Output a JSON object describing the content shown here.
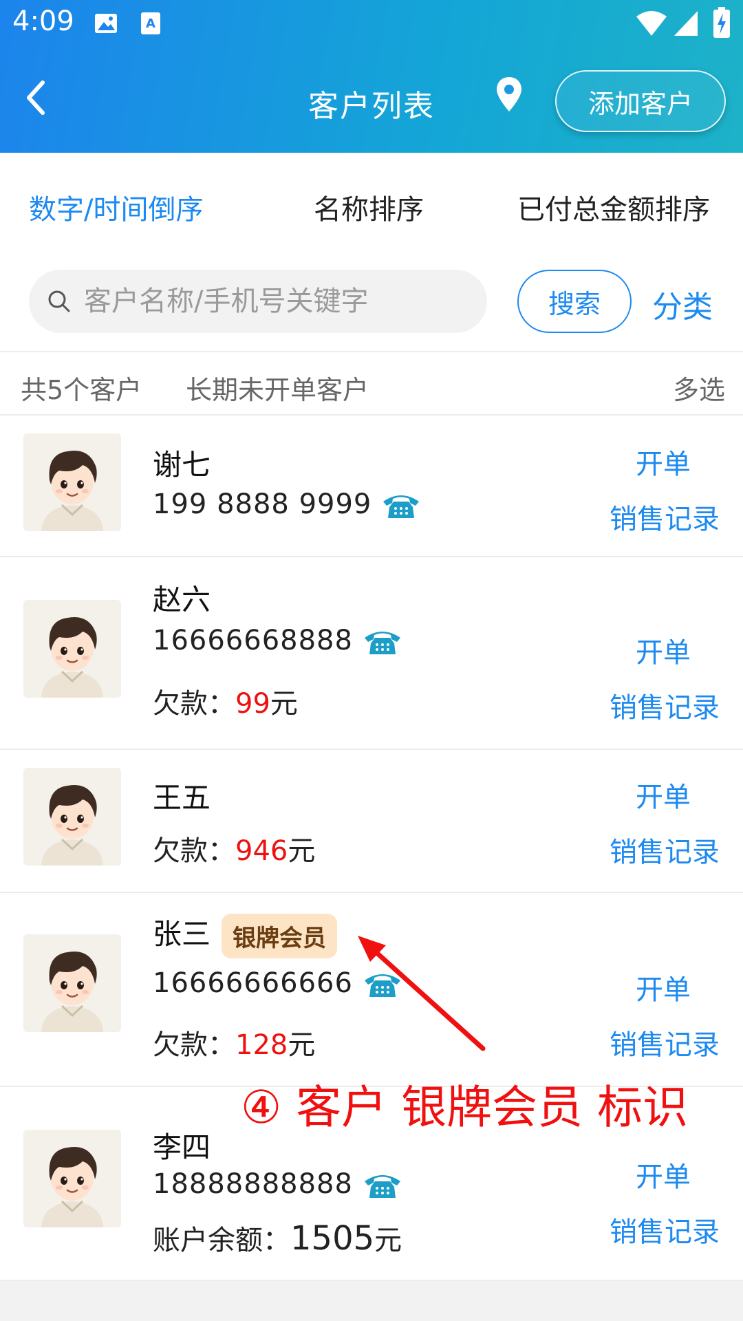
{
  "status": {
    "time": "4:09"
  },
  "header": {
    "back_icon": "chevron-left-icon",
    "title": "客户列表",
    "location_icon": "map-pin-icon",
    "add_label": "添加客户"
  },
  "sort_tabs": [
    "数字/时间倒序",
    "名称排序",
    "已付总金额排序"
  ],
  "search": {
    "placeholder": "客户名称/手机号关键字",
    "button": "搜索",
    "category": "分类"
  },
  "info": {
    "count": "共5个客户",
    "inactive": "长期未开单客户",
    "multi": "多选"
  },
  "actions": {
    "open": "开单",
    "sales": "销售记录"
  },
  "customers": [
    {
      "name": "谢七",
      "phone": "199 8888 9999"
    },
    {
      "name": "赵六",
      "phone": "16666668888",
      "debt_label": "欠款：",
      "debt": "99",
      "unit": "元"
    },
    {
      "name": "王五",
      "debt_label": "欠款：",
      "debt": "946",
      "unit": "元"
    },
    {
      "name": "张三",
      "badge": "银牌会员",
      "phone": "16666666666",
      "debt_label": "欠款：",
      "debt": "128",
      "unit": "元"
    },
    {
      "name": "李四",
      "phone": "18888888888",
      "balance_label": "账户余额：",
      "balance": "1505",
      "unit": "元"
    }
  ],
  "annotation": "④ 客户 银牌会员 标识",
  "colors": {
    "accent": "#1c8af0",
    "debt": "#ee1111",
    "header_start": "#1c84ec",
    "header_end": "#1db2c8"
  }
}
